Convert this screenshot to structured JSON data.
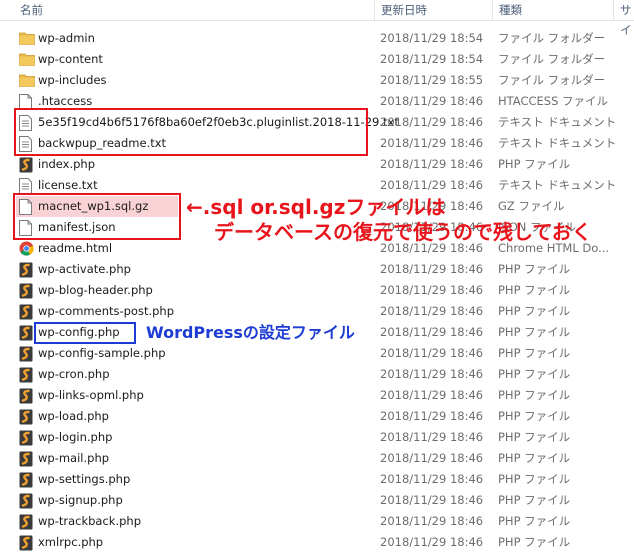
{
  "header": {
    "name": "名前",
    "date": "更新日時",
    "type": "種類",
    "size": "サイ"
  },
  "files": [
    {
      "name": "wp-admin",
      "date": "2018/11/29 18:54",
      "type": "ファイル フォルダー",
      "icon": "folder-icon"
    },
    {
      "name": "wp-content",
      "date": "2018/11/29 18:54",
      "type": "ファイル フォルダー",
      "icon": "folder-icon"
    },
    {
      "name": "wp-includes",
      "date": "2018/11/29 18:55",
      "type": "ファイル フォルダー",
      "icon": "folder-icon"
    },
    {
      "name": ".htaccess",
      "date": "2018/11/29 18:46",
      "type": "HTACCESS ファイル",
      "icon": "blank-file-icon"
    },
    {
      "name": "5e35f19cd4b6f5176f8ba60ef2f0eb3c.pluginlist.2018-11-29.txt",
      "date": "2018/11/29 18:46",
      "type": "テキスト ドキュメント",
      "icon": "text-file-icon"
    },
    {
      "name": "backwpup_readme.txt",
      "date": "2018/11/29 18:46",
      "type": "テキスト ドキュメント",
      "icon": "text-file-icon"
    },
    {
      "name": "index.php",
      "date": "2018/11/29 18:46",
      "type": "PHP ファイル",
      "icon": "php-file-icon"
    },
    {
      "name": "license.txt",
      "date": "2018/11/29 18:46",
      "type": "テキスト ドキュメント",
      "icon": "text-file-icon"
    },
    {
      "name": "macnet_wp1.sql.gz",
      "date": "2018/11/29 18:46",
      "type": "GZ ファイル",
      "icon": "blank-file-icon",
      "highlight": true
    },
    {
      "name": "manifest.json",
      "date": "2018/11/29 18:46",
      "type": "JSON ファイル",
      "icon": "blank-file-icon"
    },
    {
      "name": "readme.html",
      "date": "2018/11/29 18:46",
      "type": "Chrome HTML Do...",
      "icon": "chrome-icon"
    },
    {
      "name": "wp-activate.php",
      "date": "2018/11/29 18:46",
      "type": "PHP ファイル",
      "icon": "php-file-icon"
    },
    {
      "name": "wp-blog-header.php",
      "date": "2018/11/29 18:46",
      "type": "PHP ファイル",
      "icon": "php-file-icon"
    },
    {
      "name": "wp-comments-post.php",
      "date": "2018/11/29 18:46",
      "type": "PHP ファイル",
      "icon": "php-file-icon"
    },
    {
      "name": "wp-config.php",
      "date": "2018/11/29 18:46",
      "type": "PHP ファイル",
      "icon": "php-file-icon"
    },
    {
      "name": "wp-config-sample.php",
      "date": "2018/11/29 18:46",
      "type": "PHP ファイル",
      "icon": "php-file-icon"
    },
    {
      "name": "wp-cron.php",
      "date": "2018/11/29 18:46",
      "type": "PHP ファイル",
      "icon": "php-file-icon"
    },
    {
      "name": "wp-links-opml.php",
      "date": "2018/11/29 18:46",
      "type": "PHP ファイル",
      "icon": "php-file-icon"
    },
    {
      "name": "wp-load.php",
      "date": "2018/11/29 18:46",
      "type": "PHP ファイル",
      "icon": "php-file-icon"
    },
    {
      "name": "wp-login.php",
      "date": "2018/11/29 18:46",
      "type": "PHP ファイル",
      "icon": "php-file-icon"
    },
    {
      "name": "wp-mail.php",
      "date": "2018/11/29 18:46",
      "type": "PHP ファイル",
      "icon": "php-file-icon"
    },
    {
      "name": "wp-settings.php",
      "date": "2018/11/29 18:46",
      "type": "PHP ファイル",
      "icon": "php-file-icon"
    },
    {
      "name": "wp-signup.php",
      "date": "2018/11/29 18:46",
      "type": "PHP ファイル",
      "icon": "php-file-icon"
    },
    {
      "name": "wp-trackback.php",
      "date": "2018/11/29 18:46",
      "type": "PHP ファイル",
      "icon": "php-file-icon"
    },
    {
      "name": "xmlrpc.php",
      "date": "2018/11/29 18:46",
      "type": "PHP ファイル",
      "icon": "php-file-icon"
    }
  ],
  "annotations": {
    "sql_line1": "←.sql or.sql.gzファイルは",
    "sql_line2": "データベースの復元で使うので残しておく",
    "config": "WordPressの設定ファイル"
  },
  "colors": {
    "annotation_red": "#e8141c",
    "annotation_blue": "#1d3cd4",
    "highlight_row": "#f8d2d4",
    "folder": "#e8b84a",
    "php": "#3a3a3a"
  }
}
